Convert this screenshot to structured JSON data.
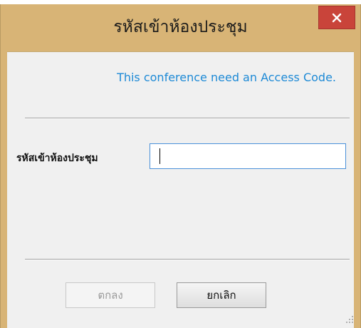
{
  "window": {
    "title": "รหัสเข้าห้องประชุม",
    "close_icon": "close-icon"
  },
  "dialog": {
    "info_text": "This conference need an Access Code.",
    "code_label": "รหัสเข้าห้องประชุม",
    "code_value": "",
    "ok_label": "ตกลง",
    "cancel_label": "ยกเลิก"
  },
  "colors": {
    "frame": "#d8b476",
    "close_button": "#c9443a",
    "info_text": "#1e8ad6",
    "input_border": "#4a90d9"
  }
}
